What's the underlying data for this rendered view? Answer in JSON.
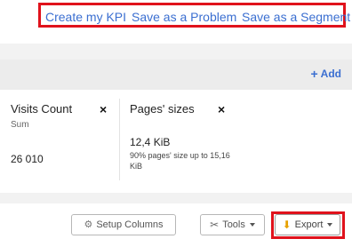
{
  "top_actions": {
    "create_kpi": "Create my KPI",
    "save_problem": "Save as a Problem",
    "save_segment": "Save as a Segment"
  },
  "toolbar": {
    "add_label": "Add"
  },
  "cards": [
    {
      "title": "Visits Count",
      "subtitle": "Sum",
      "value": "26 010",
      "note": ""
    },
    {
      "title": "Pages' sizes",
      "subtitle": "",
      "value": "12,4 KiB",
      "note": "90% pages' size up to 15,16 KiB"
    }
  ],
  "bottom_buttons": {
    "setup_columns": "Setup Columns",
    "tools": "Tools",
    "export": "Export"
  },
  "icons": {
    "close": "close-icon",
    "plus": "plus-icon",
    "gear": "gear-icon",
    "wrench": "wrench-icon",
    "download": "download-icon"
  },
  "colors": {
    "link_blue": "#3b6fd1",
    "highlight_red": "#e0121c",
    "download_yellow": "#e7a100"
  }
}
